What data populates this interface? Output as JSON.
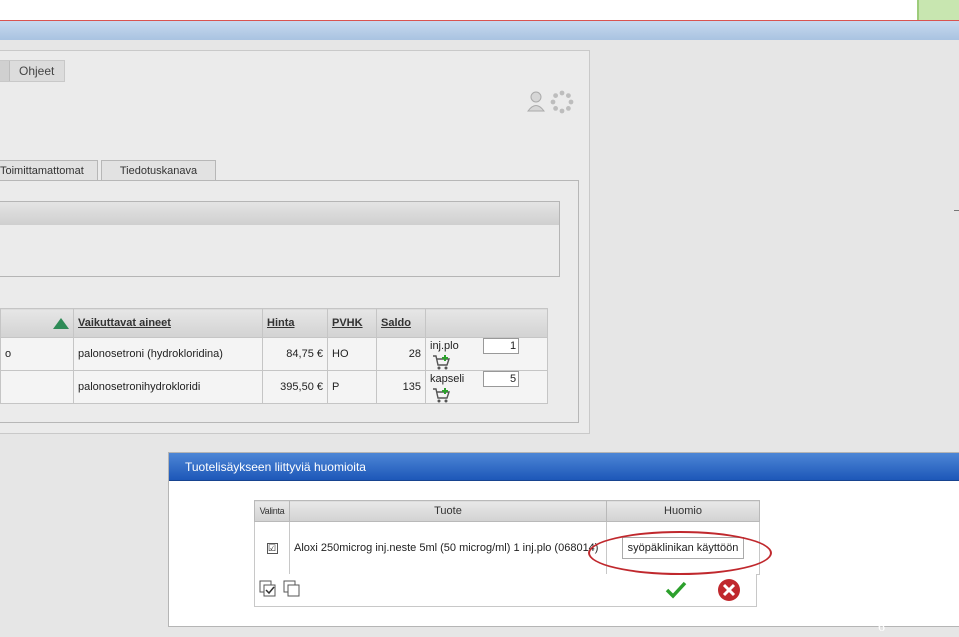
{
  "header": {
    "help_label": "Ohjeet"
  },
  "icons": {
    "user": "user-icon",
    "spinner": "loading-icon",
    "cart": "cart-add-icon",
    "sort": "sort-asc-icon"
  },
  "tabs": [
    {
      "label": "Toimittamattomat"
    },
    {
      "label": "Tiedotuskanava"
    }
  ],
  "product_table": {
    "headers": {
      "substances": "Vaikuttavat aineet",
      "price": "Hinta",
      "pvhk": "PVHK",
      "stock": "Saldo"
    },
    "rows": [
      {
        "name_fragment": "o",
        "substance": "palonosetroni (hydrokloridina)",
        "price": "84,75 €",
        "pvhk": "HO",
        "stock": "28",
        "form": "inj.plo",
        "qty": "1"
      },
      {
        "name_fragment": "",
        "substance": "palonosetronihydrokloridi",
        "price": "395,50 €",
        "pvhk": "P",
        "stock": "135",
        "form": "kapseli",
        "qty": "5"
      }
    ]
  },
  "dialog": {
    "title": "Tuotelisäykseen liittyviä huomioita",
    "headers": {
      "select": "Valinta",
      "product": "Tuote",
      "note": "Huomio"
    },
    "row": {
      "checked": "☑",
      "product": "Aloxi 250microg inj.neste 5ml (50 microg/ml) 1 inj.plo (068014)",
      "note": "syöpäklinikan käyttöön"
    }
  },
  "page_number": "6",
  "colors": {
    "accent_blue": "#1d57b8",
    "highlight_red": "#c0282d",
    "ok_green": "#2ca02c"
  }
}
